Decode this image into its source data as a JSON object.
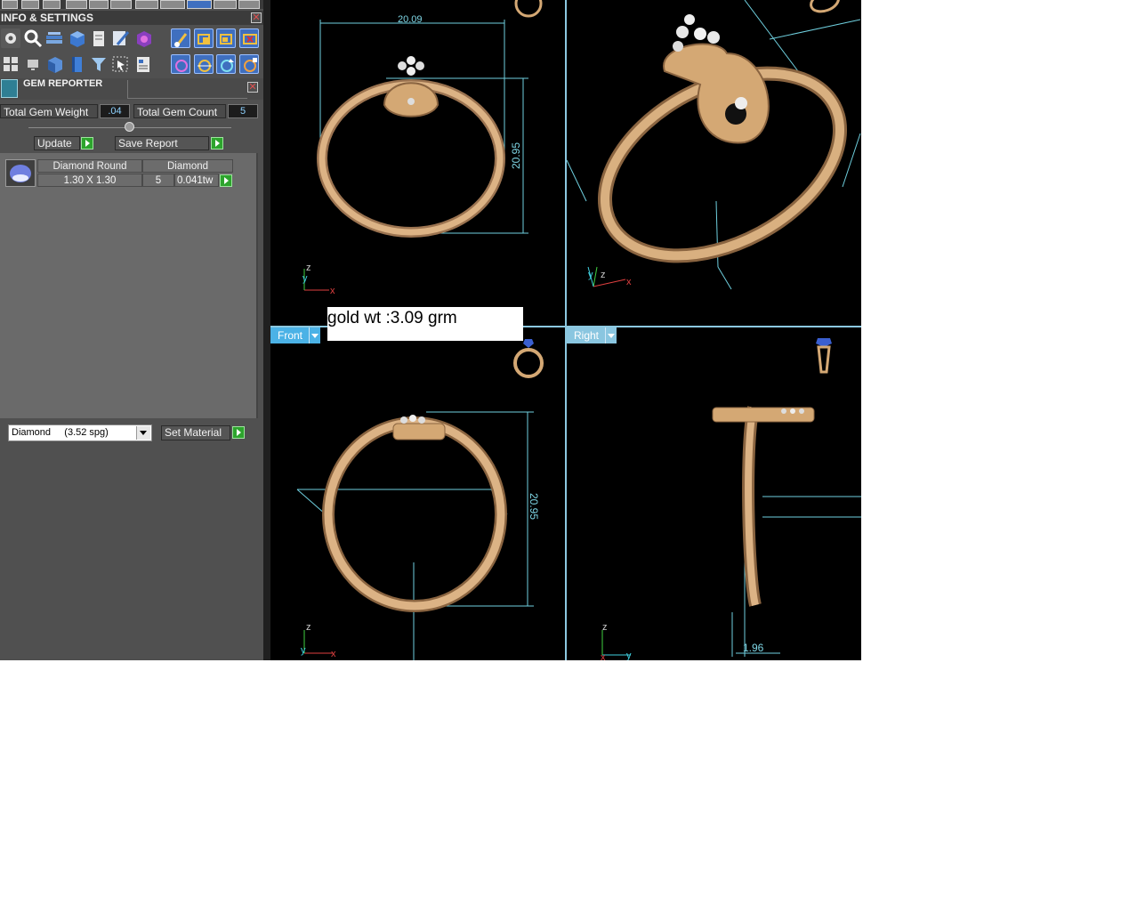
{
  "info_panel": {
    "title": "INFO & SETTINGS"
  },
  "gem_reporter": {
    "title": "GEM REPORTER",
    "total_weight_label": "Total Gem Weight",
    "total_weight_value": ".04",
    "total_count_label": "Total Gem Count",
    "total_count_value": "5",
    "update_label": "Update",
    "save_report_label": "Save Report",
    "rows": [
      {
        "shape": "Diamond Round",
        "type": "Diamond",
        "size": "1.30 X 1.30",
        "count": "5",
        "weight": "0.041tw"
      }
    ]
  },
  "material": {
    "selected": "Diamond     (3.52 spg)",
    "set_label": "Set Material"
  },
  "viewports": {
    "front_label": "Front",
    "right_label": "Right",
    "top_dim_width": "20.09",
    "top_dim_height": "20.95",
    "front_dim_height": "20.95",
    "right_dim_width": "1.96",
    "axis_x": "x",
    "axis_y": "y",
    "axis_z": "z"
  },
  "note": {
    "text": "gold wt :3.09 grm"
  },
  "colors": {
    "gold": "#d4a874",
    "dimension_line": "#6fd0df",
    "tab_active": "#4bb2e6",
    "tab_inactive": "#8ac6e0"
  }
}
